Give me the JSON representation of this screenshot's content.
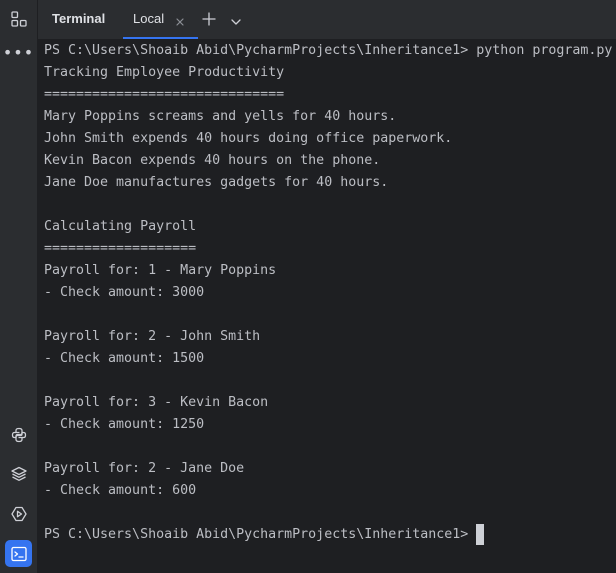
{
  "toolwindow": {
    "title": "Terminal",
    "tabs": [
      {
        "label": "Local",
        "active": true
      }
    ],
    "accent_color": "#3574f0"
  },
  "sidebar": {
    "top_icons": [
      "structure-icon",
      "more-icon"
    ],
    "bottom_icons": [
      "python-packages-icon",
      "layers-icon",
      "run-services-icon",
      "terminal-icon"
    ],
    "active_icon": "terminal-icon"
  },
  "terminal": {
    "lines": [
      "PS C:\\Users\\Shoaib Abid\\PycharmProjects\\Inheritance1> python program.py",
      "Tracking Employee Productivity",
      "==============================",
      "Mary Poppins screams and yells for 40 hours.",
      "John Smith expends 40 hours doing office paperwork.",
      "Kevin Bacon expends 40 hours on the phone.",
      "Jane Doe manufactures gadgets for 40 hours.",
      "",
      "Calculating Payroll",
      "===================",
      "Payroll for: 1 - Mary Poppins",
      "- Check amount: 3000",
      "",
      "Payroll for: 2 - John Smith",
      "- Check amount: 1500",
      "",
      "Payroll for: 3 - Kevin Bacon",
      "- Check amount: 1250",
      "",
      "Payroll for: 2 - Jane Doe",
      "- Check amount: 600",
      "",
      "PS C:\\Users\\Shoaib Abid\\PycharmProjects\\Inheritance1> "
    ]
  }
}
